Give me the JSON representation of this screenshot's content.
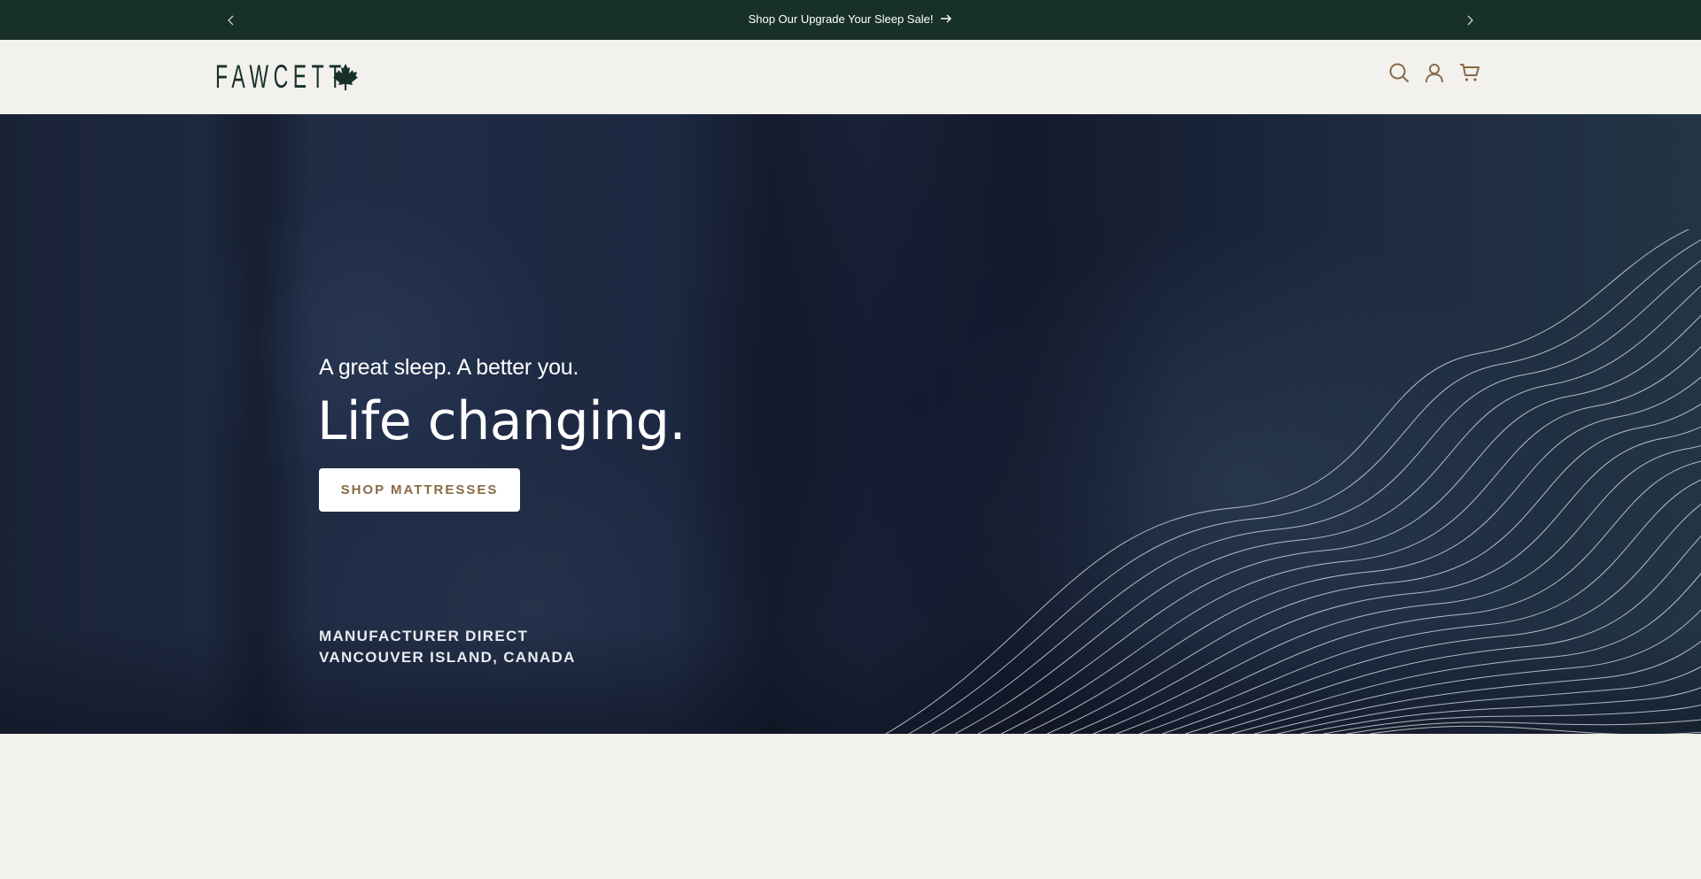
{
  "announcement": {
    "message": "Shop Our Upgrade Your Sleep Sale!",
    "prev_icon": "chevron-left-icon",
    "next_icon": "chevron-right-icon",
    "arrow_icon": "arrow-right-icon"
  },
  "header": {
    "logo_text": "FAWCETT",
    "logo_icon": "maple-leaf-icon",
    "icons": [
      "search-icon",
      "account-icon",
      "cart-icon"
    ]
  },
  "hero": {
    "kicker": "A great sleep. A better you.",
    "headline": "Life changing.",
    "cta_label": "SHOP MATTRESSES",
    "tagline_1": "MANUFACTURER DIRECT",
    "tagline_2": "VANCOUVER ISLAND, CANADA"
  },
  "colors": {
    "announcement_bg": "#18302a",
    "page_bg": "#f3f1ed",
    "accent_brown": "#8a6a46",
    "logo_green": "#18302a"
  }
}
